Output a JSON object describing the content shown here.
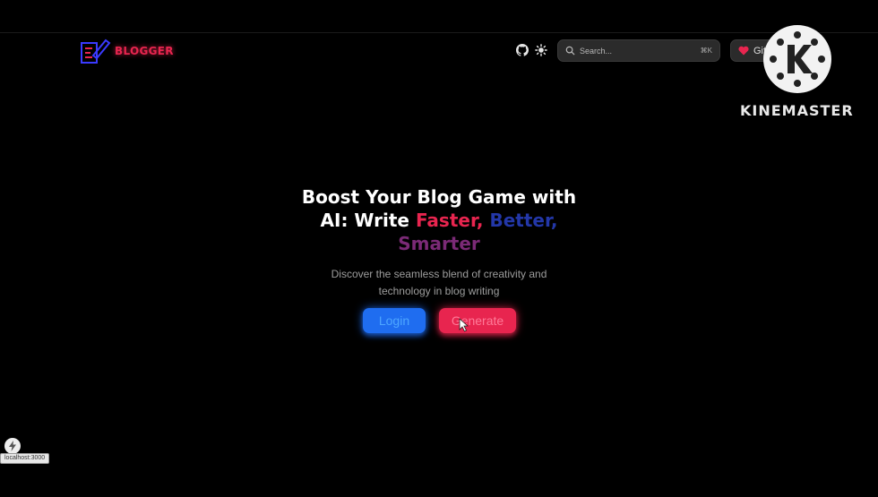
{
  "header": {
    "logo_text": "BLOGGER",
    "search": {
      "placeholder": "Search...",
      "shortcut": "⌘K"
    },
    "sponsor_label": "Gitar",
    "icons": [
      "github-icon",
      "sun-icon",
      "search-icon",
      "heart-icon"
    ]
  },
  "watermark": {
    "text": "KINEMASTER"
  },
  "hero": {
    "title_line1": "Boost Your Blog Game with",
    "title_line2_prefix": "AI: Write",
    "word_faster": "Faster,",
    "word_better": "Better,",
    "word_smarter": "Smarter",
    "subtitle_line1": "Discover the seamless blend of creativity and",
    "subtitle_line2": "technology in blog writing",
    "login_label": "Login",
    "generate_label": "Generate"
  },
  "status": {
    "url": "localhost:3000"
  },
  "colors": {
    "accent_red": "#e8254f",
    "accent_blue": "#1f6df0",
    "better_blue": "#2337a8",
    "smarter_purple": "#7b2a76",
    "background": "#000000"
  }
}
